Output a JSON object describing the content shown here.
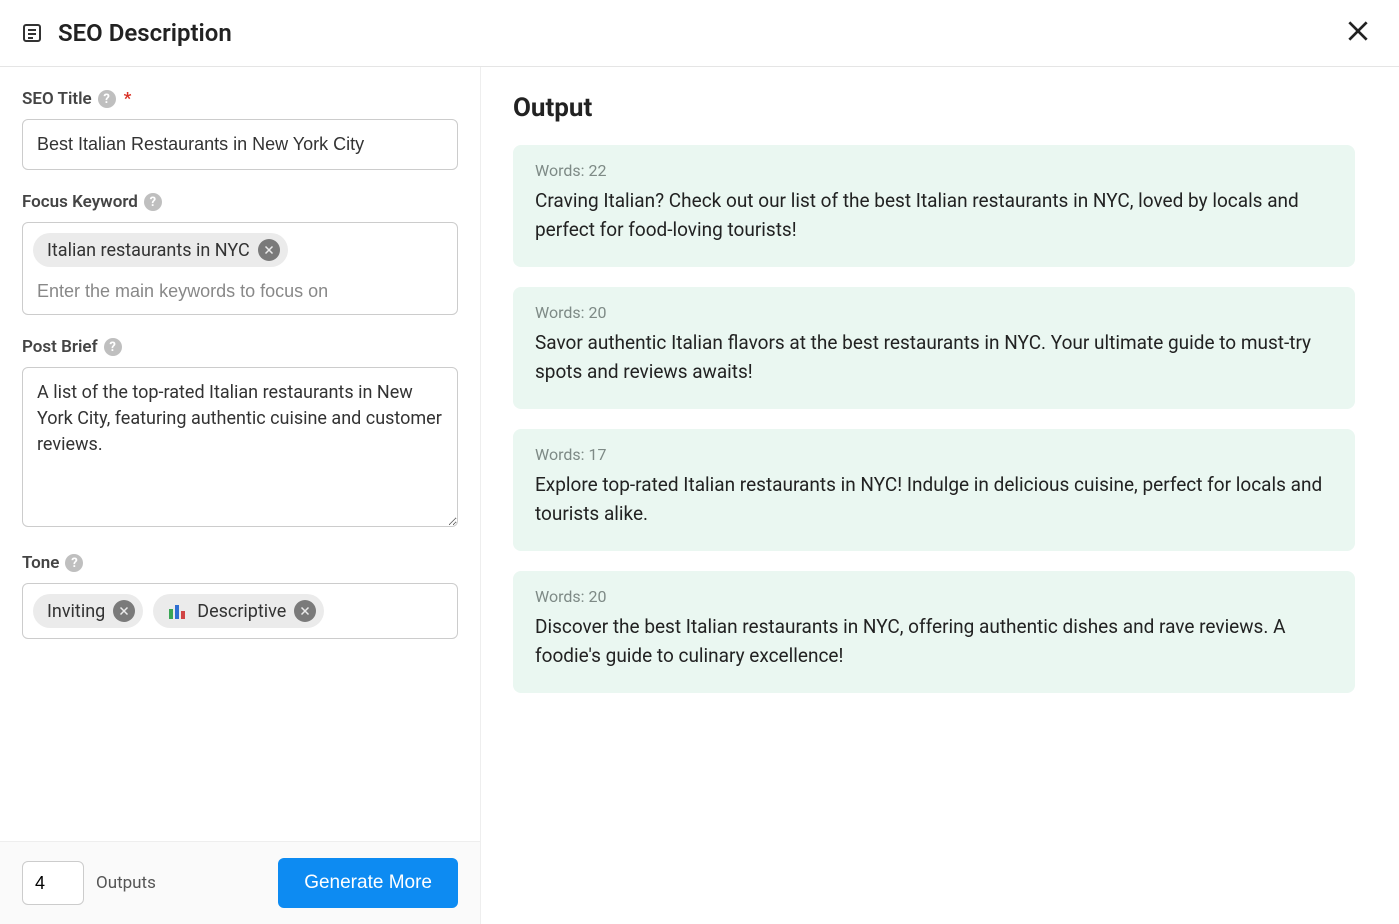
{
  "header": {
    "title": "SEO Description"
  },
  "form": {
    "seo_title": {
      "label": "SEO Title",
      "required_marker": "*",
      "value": "Best Italian Restaurants in New York City"
    },
    "focus_keyword": {
      "label": "Focus Keyword",
      "placeholder": "Enter the main keywords to focus on",
      "tags": [
        "Italian restaurants in NYC"
      ]
    },
    "post_brief": {
      "label": "Post Brief",
      "value": "A list of the top-rated Italian restaurants in New York City, featuring authentic cuisine and customer reviews."
    },
    "tone": {
      "label": "Tone",
      "tags": [
        {
          "label": "Inviting",
          "has_icon": false
        },
        {
          "label": "Descriptive",
          "has_icon": true
        }
      ]
    }
  },
  "footer": {
    "outputs_count": "4",
    "outputs_label": "Outputs",
    "button_label": "Generate More"
  },
  "output": {
    "heading": "Output",
    "words_prefix": "Words: ",
    "items": [
      {
        "words": 22,
        "text": "Craving Italian? Check out our list of the best Italian restaurants in NYC, loved by locals and perfect for food-loving tourists!"
      },
      {
        "words": 20,
        "text": "Savor authentic Italian flavors at the best restaurants in NYC. Your ultimate guide to must-try spots and reviews awaits!"
      },
      {
        "words": 17,
        "text": "Explore top-rated Italian restaurants in NYC! Indulge in delicious cuisine, perfect for locals and tourists alike."
      },
      {
        "words": 20,
        "text": "Discover the best Italian restaurants in NYC, offering authentic dishes and rave reviews. A foodie's guide to culinary excellence!"
      }
    ]
  }
}
